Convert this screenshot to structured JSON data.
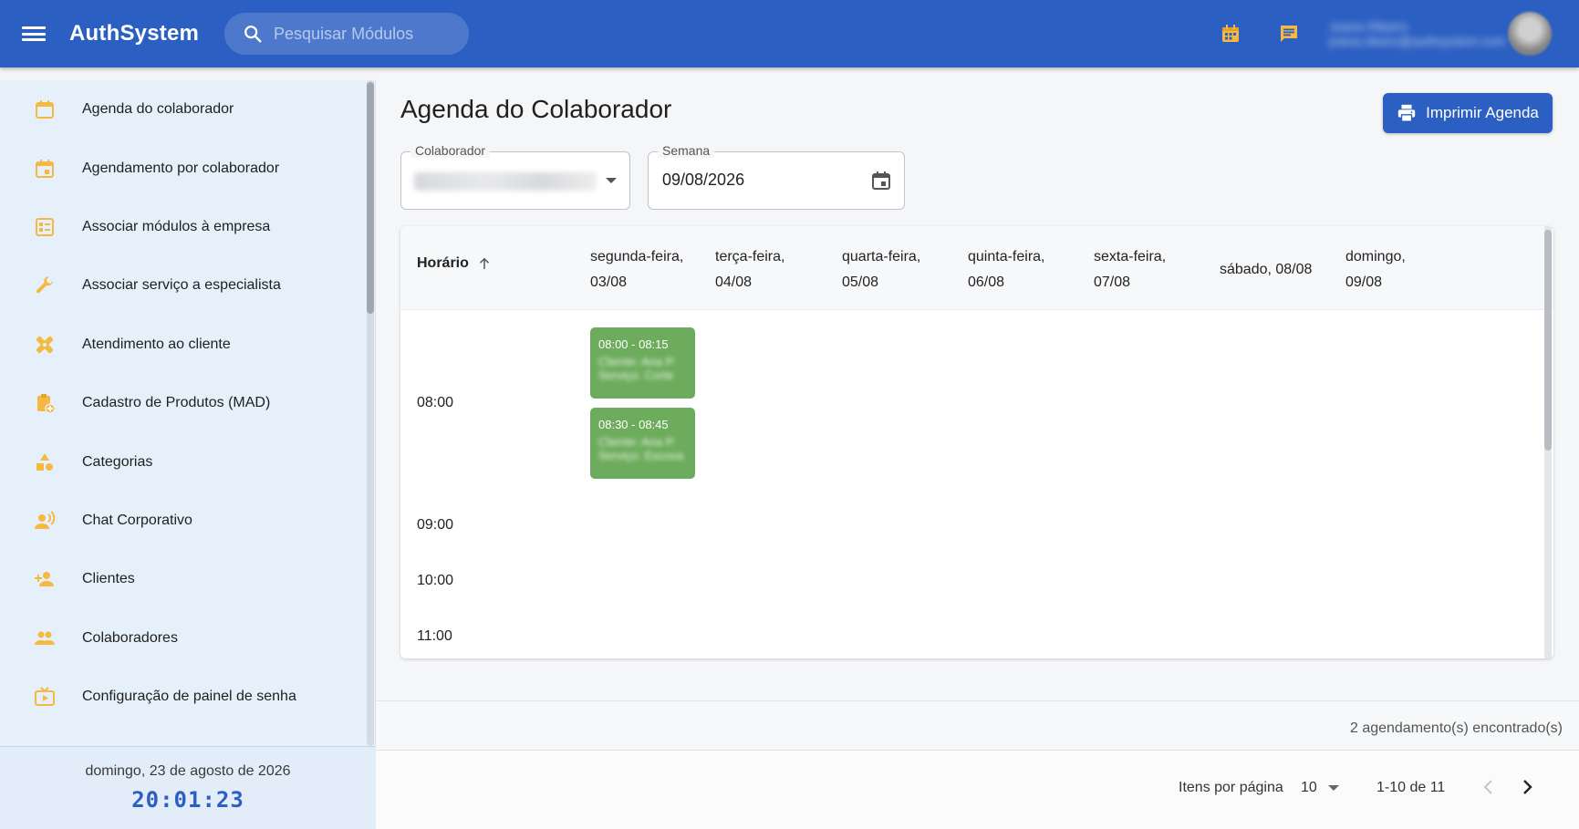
{
  "header": {
    "brand": "AuthSystem",
    "search_placeholder": "Pesquisar Módulos",
    "user_name": "Joana Ribeiro",
    "user_email": "joana.ribeiro@authsystem.com"
  },
  "sidebar": {
    "items": [
      {
        "label": "Agenda do colaborador",
        "icon": "calendar-today-icon"
      },
      {
        "label": "Agendamento por colaborador",
        "icon": "event-icon"
      },
      {
        "label": "Associar módulos à empresa",
        "icon": "ballot-icon"
      },
      {
        "label": "Associar serviço a especialista",
        "icon": "wrench-icon"
      },
      {
        "label": "Atendimento ao cliente",
        "icon": "healing-icon"
      },
      {
        "label": "Cadastro de Produtos (MAD)",
        "icon": "assignment-add-icon"
      },
      {
        "label": "Categorias",
        "icon": "category-icon"
      },
      {
        "label": "Chat Corporativo",
        "icon": "record-voice-icon"
      },
      {
        "label": "Clientes",
        "icon": "person-add-icon"
      },
      {
        "label": "Colaboradores",
        "icon": "people-icon"
      },
      {
        "label": "Configuração de painel de senha",
        "icon": "live-tv-icon"
      }
    ],
    "date": "domingo, 23 de agosto de 2026",
    "clock": "20:01:23"
  },
  "main": {
    "title": "Agenda do Colaborador",
    "print_label": "Imprimir Agenda",
    "colaborador_label": "Colaborador",
    "colaborador_value": "(T) Vanessa Pina Rosso",
    "semana_label": "Semana",
    "semana_value": "09/08/2026"
  },
  "calendar": {
    "time_header": "Horário",
    "days": [
      {
        "line1": "segunda-feira,",
        "line2": "03/08"
      },
      {
        "line1": "terça-feira,",
        "line2": "04/08"
      },
      {
        "line1": "quarta-feira,",
        "line2": "05/08"
      },
      {
        "line1": "quinta-feira,",
        "line2": "06/08"
      },
      {
        "line1": "sexta-feira,",
        "line2": "07/08"
      },
      {
        "line1": "sábado, 08/08",
        "line2": ""
      },
      {
        "line1": "domingo,",
        "line2": "09/08"
      }
    ],
    "times": [
      "08:00",
      "09:00",
      "10:00",
      "11:00"
    ],
    "appointments": [
      {
        "time": "08:00 - 08:15",
        "client": "Cliente: Ana P.",
        "service": "Serviço: Corte"
      },
      {
        "time": "08:30 - 08:45",
        "client": "Cliente: Ana P.",
        "service": "Serviço: Escova"
      }
    ]
  },
  "footer": {
    "count": "2 agendamento(s) encontrado(s)",
    "items_per_page_label": "Itens por página",
    "page_size": "10",
    "range": "1-10 de 11"
  },
  "colors": {
    "primary": "#2c5fc2",
    "sidebar_bg": "#e6f0fb",
    "icon_accent": "#f5b942",
    "appointment": "#6dac5c"
  }
}
